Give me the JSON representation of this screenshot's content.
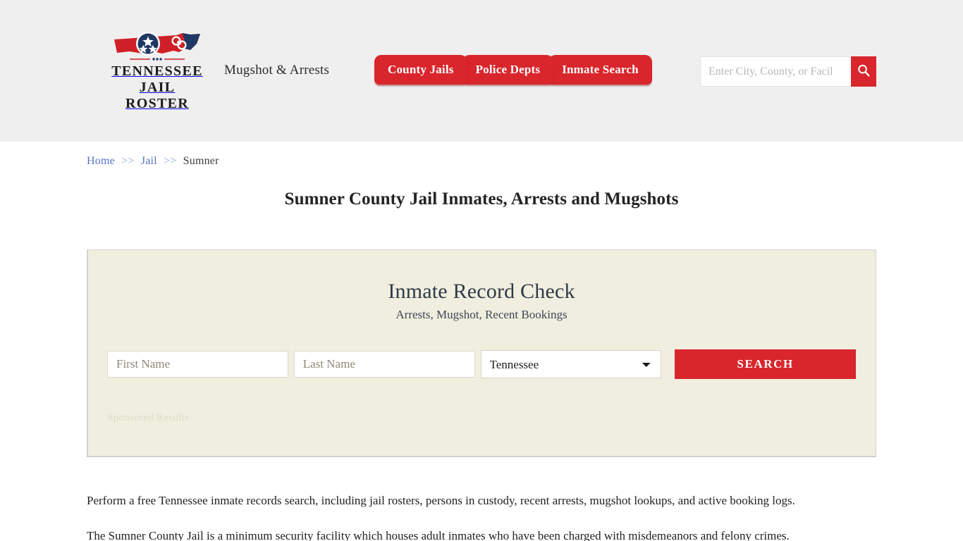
{
  "header": {
    "logo_icon": "tennessee-state-handcuffs-logo",
    "brand_name": "TENNESSEE\nJAIL ROSTER",
    "tagline": "Mugshot & Arrests",
    "nav": [
      {
        "label": "County Jails"
      },
      {
        "label": "Police Depts"
      },
      {
        "label": "Inmate Search"
      }
    ],
    "search": {
      "placeholder": "Enter City, County, or Facil",
      "value": "",
      "icon": "search-icon"
    },
    "accent_color": "#d9252c",
    "background_color": "#efefef"
  },
  "breadcrumb": {
    "items": [
      {
        "label": "Home",
        "link": true
      },
      {
        "label": "Jail",
        "link": true
      },
      {
        "label": "Sumner",
        "link": false
      }
    ],
    "separator": ">>"
  },
  "page": {
    "title": "Sumner County Jail Inmates, Arrests and Mugshots"
  },
  "record_panel": {
    "title": "Inmate Record Check",
    "subtitle": "Arrests, Mugshot, Recent Bookings",
    "first_name_placeholder": "First Name",
    "first_name_value": "",
    "last_name_placeholder": "Last Name",
    "last_name_value": "",
    "state_selected": "Tennessee",
    "state_options": [
      "Tennessee"
    ],
    "search_button": "SEARCH",
    "sponsored_label": "Sponsored Results",
    "background_color": "#f0eedf"
  },
  "body": {
    "paragraphs": [
      "Perform a free Tennessee inmate records search, including jail rosters, persons in custody, recent arrests, mugshot lookups, and active booking logs.",
      "The Sumner County Jail is a minimum security facility which houses adult inmates who have been charged with misdemeanors and felony crimes."
    ]
  }
}
